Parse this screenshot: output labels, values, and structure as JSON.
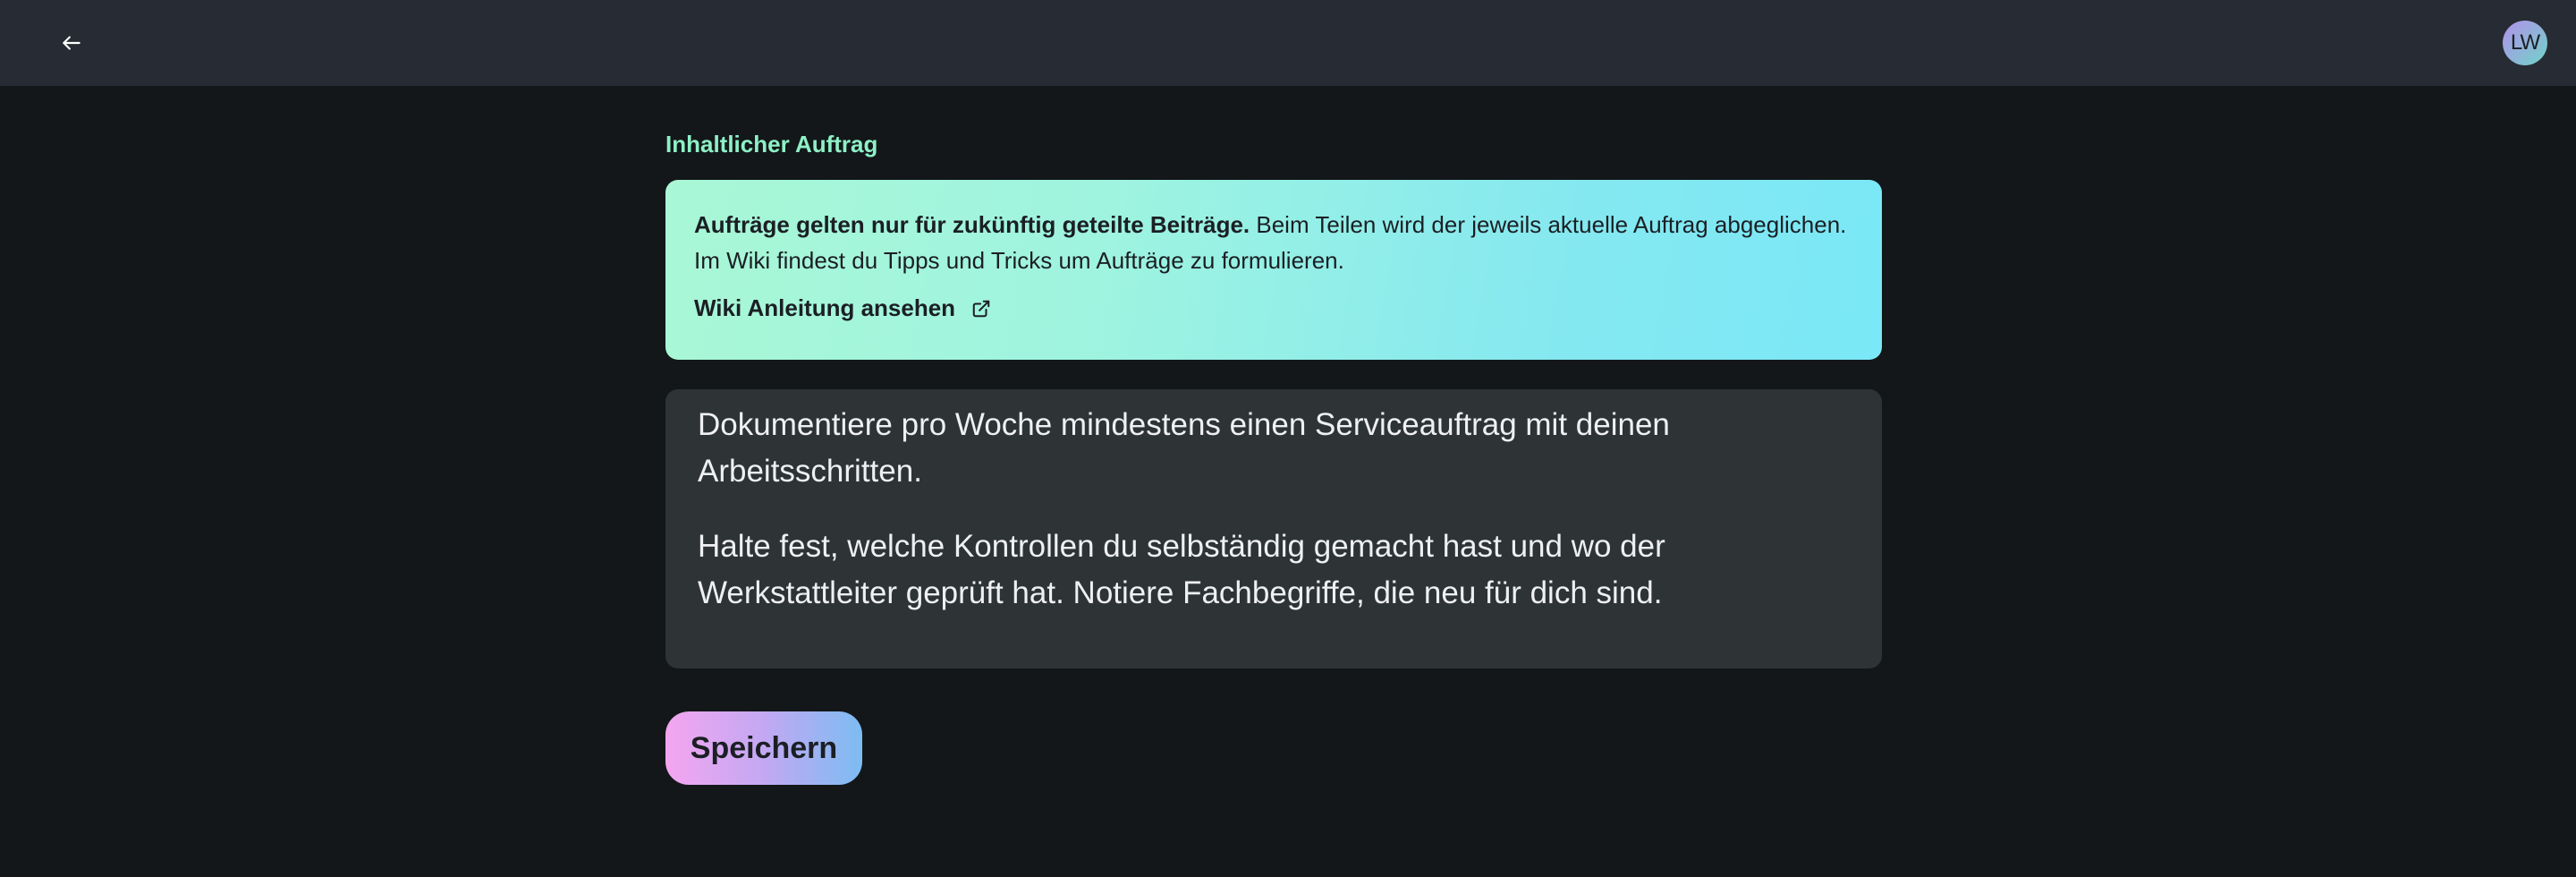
{
  "topbar": {
    "back_icon": "arrow-left-icon",
    "avatar_initials": "LW"
  },
  "section": {
    "label": "Inhaltlicher Auftrag"
  },
  "info": {
    "bold_text": "Aufträge gelten nur für zukünftig geteilte Beiträge.",
    "text": " Beim Teilen wird der jeweils aktuelle Auftrag abgeglichen. Im Wiki findest du Tipps und Tricks um Aufträge zu formulieren.",
    "link_label": "Wiki Anleitung ansehen",
    "link_icon": "external-link-icon"
  },
  "editor": {
    "paragraph_1": "Dokumentiere pro Woche mindestens einen Serviceauftrag mit deinen Arbeitsschritten.",
    "paragraph_2": "Halte fest, welche Kontrollen du selbständig gemacht hast und wo der Werkstattleiter geprüft hat. Notiere Fachbegriffe, die neu für dich sind."
  },
  "actions": {
    "save_label": "Speichern"
  },
  "colors": {
    "background": "#131719",
    "topbar": "#272b33",
    "accent_label": "#8ef0c7",
    "editor_bg": "#2e3336"
  }
}
